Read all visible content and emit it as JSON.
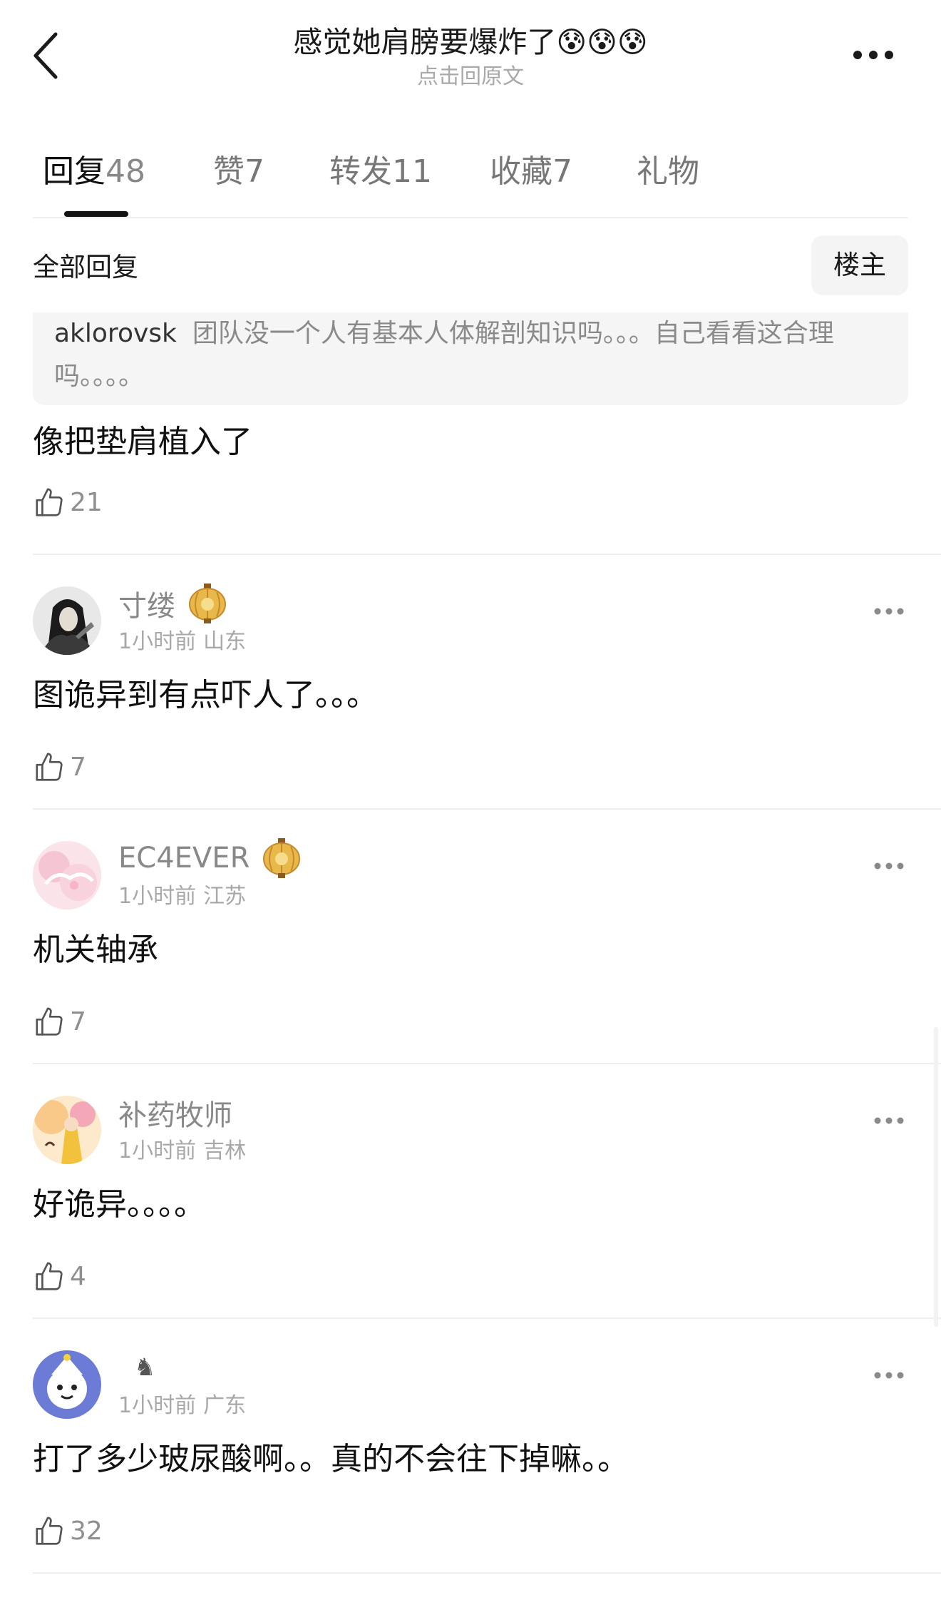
{
  "header": {
    "title": "感觉她肩膀要爆炸了😰😰😰",
    "subtitle": "点击回原文"
  },
  "tabs": [
    {
      "label": "回复",
      "count": "48"
    },
    {
      "label": "赞",
      "count": "7"
    },
    {
      "label": "转发",
      "count": "11"
    },
    {
      "label": "收藏",
      "count": "7"
    },
    {
      "label": "礼物",
      "count": ""
    }
  ],
  "section": {
    "title": "全部回复",
    "op_button": "楼主"
  },
  "quoted": {
    "username": "aklorovsk",
    "text": "团队没一个人有基本人体解剖知识吗。。。自己看看这合理吗。。。。"
  },
  "first_reply": {
    "text": "像把垫肩植入了",
    "likes": "21"
  },
  "comments": [
    {
      "username": "寸缕",
      "time": "1小时前",
      "location": "山东",
      "text": "图诡异到有点吓人了。。。",
      "likes": "7",
      "badge": "lantern-icon"
    },
    {
      "username": "EC4EVER",
      "time": "1小时前",
      "location": "江苏",
      "text": "机关轴承",
      "likes": "7",
      "badge": "lantern-icon"
    },
    {
      "username": "补药牧师",
      "time": "1小时前",
      "location": "吉林",
      "text": "好诡异。。。。",
      "likes": "4",
      "badge": ""
    },
    {
      "username": "♞",
      "time": "1小时前",
      "location": "广东",
      "text": "打了多少玻尿酸啊。。真的不会往下掉嘛。。",
      "likes": "32",
      "badge": ""
    }
  ],
  "colors": {
    "text_primary": "#111111",
    "text_secondary": "#888888",
    "text_meta": "#a8a8a8",
    "quote_bg": "#f5f5f5",
    "divider": "#eeeeee"
  }
}
